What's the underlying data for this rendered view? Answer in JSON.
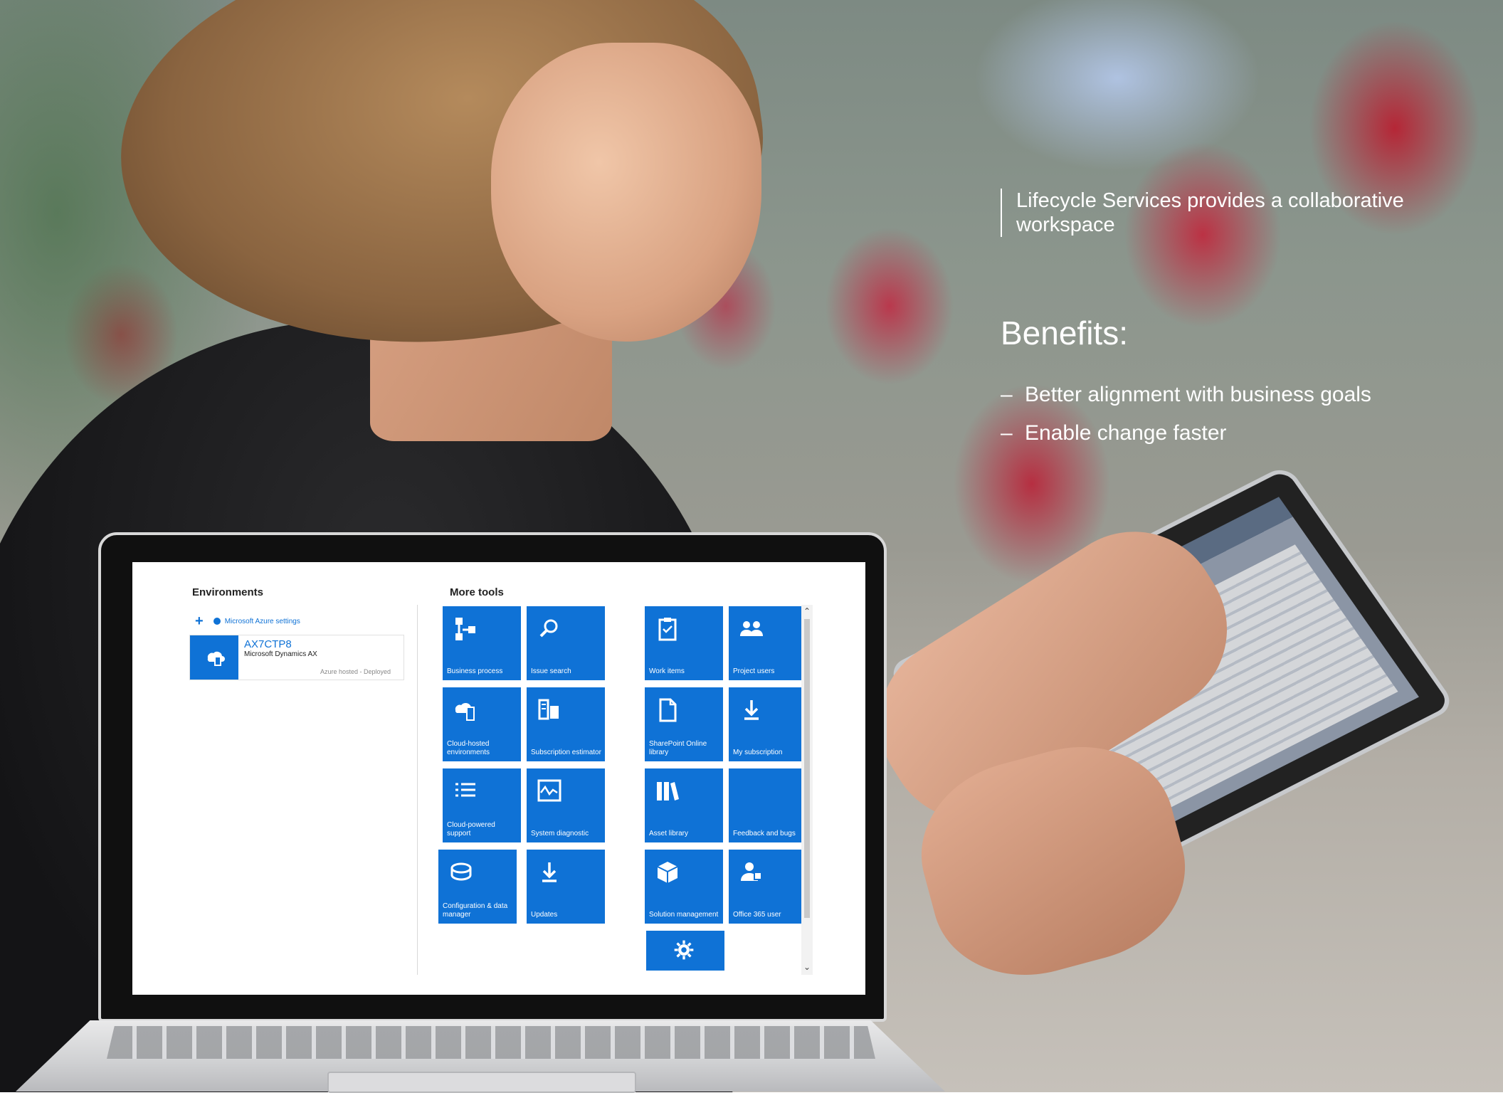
{
  "caption": "Lifecycle Services provides a collaborative workspace",
  "benefits": {
    "title": "Benefits:",
    "items": [
      "Better alignment with business goals",
      "Enable change faster"
    ]
  },
  "lcs_screen": {
    "environments_title": "Environments",
    "azure_link": "Microsoft Azure settings",
    "environment": {
      "name": "AX7CTP8",
      "product": "Microsoft Dynamics AX",
      "status": "Azure hosted - Deployed"
    },
    "more_tools_title": "More tools",
    "tiles": [
      {
        "label": "Business process",
        "icon": "business-process-icon"
      },
      {
        "label": "Issue search",
        "icon": "search-icon"
      },
      {
        "label": "Work items",
        "icon": "clipboard-icon"
      },
      {
        "label": "Project users",
        "icon": "users-icon"
      },
      {
        "label": "Cloud-hosted environments",
        "icon": "cloud-server-icon"
      },
      {
        "label": "Subscription estimator",
        "icon": "estimator-icon"
      },
      {
        "label": "SharePoint Online library",
        "icon": "document-icon"
      },
      {
        "label": "My subscription",
        "icon": "download-icon"
      },
      {
        "label": "Cloud-powered support",
        "icon": "list-icon"
      },
      {
        "label": "System diagnostic",
        "icon": "diagnostic-icon"
      },
      {
        "label": "Asset library",
        "icon": "books-icon"
      },
      {
        "label": "Feedback and bugs",
        "icon": "feedback-icon"
      },
      {
        "label": "Configuration & data manager",
        "icon": "config-icon"
      },
      {
        "label": "Updates",
        "icon": "download-icon"
      },
      {
        "label": "Solution management",
        "icon": "box-icon"
      },
      {
        "label": "Office 365 user",
        "icon": "user-icon"
      },
      {
        "label": "",
        "icon": "gear-icon"
      }
    ]
  },
  "colors": {
    "tile_blue": "#0f72d6",
    "text_white": "#ffffff"
  }
}
